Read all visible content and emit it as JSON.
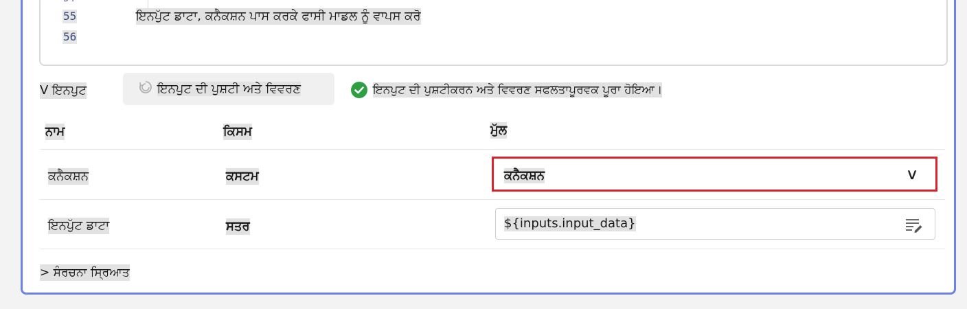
{
  "code": {
    "partial_line_number": "54",
    "line_numbers": [
      "55",
      "56"
    ],
    "line_55_text": "ਇਨਪੁੱਟ ਡਾਟਾ, ਕਨੈਕਸ਼ਨ ਪਾਸ ਕਰਕੇ ਫਾਸੀ ਮਾਡਲ ਨੂੰ ਵਾਪਸ ਕਰੋ"
  },
  "inputs": {
    "section_label": "V ਇਨਪੁਟ",
    "validate_button_label": "ਇਨਪੁਟ ਦੀ ਪੁਸ਼ਟੀ ਅਤੇ ਵਿਵਰਣ",
    "validate_icon": "refresh-icon",
    "status_icon": "check-circle-icon",
    "status_color": "#2ea043",
    "status_text": "ਇਨਪੁਟ ਦੀ ਪੁਸ਼ਟੀਕਰਨ ਅਤੇ ਵਿਵਰਣ ਸਫਲਤਾਪੂਰਵਕ ਪੂਰਾ ਹੋਇਆ।"
  },
  "table": {
    "headers": {
      "name": "ਨਾਮ",
      "type": "ਕਿਸਮ",
      "value": "ਮੁੱਲ"
    },
    "rows": [
      {
        "name": "ਕਨੈਕਸ਼ਨ",
        "type": "ਕਸਟਮ",
        "value": "ਕਨੈਕਸ਼ਨ"
      },
      {
        "name": "ਇਨਪੁੱਟ ਡਾਟਾ",
        "type": "ਸਤਰ",
        "value": "${inputs.input_data}"
      }
    ]
  },
  "advanced_label": "> ਸੰਰਚਨਾ ਸ੍ਰਿਆਤ",
  "colors": {
    "accent_border": "#6b83e6",
    "focus_outline": "#e0202a"
  }
}
